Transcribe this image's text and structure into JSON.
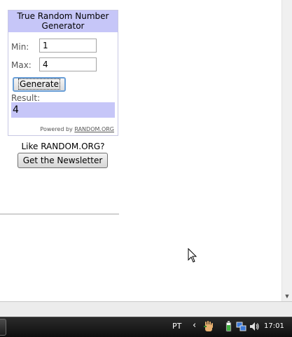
{
  "widget": {
    "title": "True Random Number Generator",
    "min_label": "Min:",
    "min_value": "1",
    "max_label": "Max:",
    "max_value": "4",
    "generate_label": "Generate",
    "result_label": "Result:",
    "result_value": "4",
    "powered_prefix": "Powered by",
    "powered_link": "RANDOM.ORG"
  },
  "promo": {
    "like_text": "Like RANDOM.ORG?",
    "newsletter_label": "Get the Newsletter"
  },
  "taskbar": {
    "language": "PT",
    "clock": "17:01",
    "tray_icons": [
      "hand-icon",
      "battery-icon",
      "network-icon",
      "volume-icon"
    ]
  }
}
